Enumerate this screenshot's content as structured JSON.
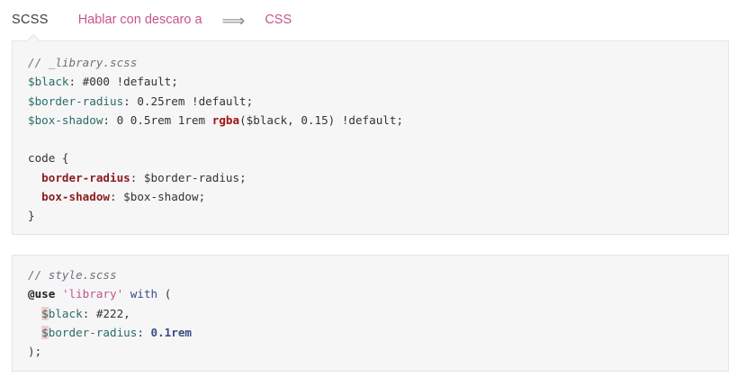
{
  "tabs": {
    "scss": "SCSS",
    "middle": "Hablar con descaro a",
    "arrow": "⟹",
    "css": "CSS"
  },
  "block1": {
    "l1_comment": "// _library.scss",
    "l2_var": "$black",
    "l2_rest": ": #000 ",
    "l2_flag": "!default;",
    "l3_var": "$border-radius",
    "l3_rest": ": 0.25rem ",
    "l3_flag": "!default;",
    "l4_var": "$box-shadow",
    "l4_rest": ": 0 0.5rem 1rem ",
    "l4_fn": "rgba",
    "l4_args": "($black, 0.15) ",
    "l4_flag": "!default;",
    "l6_sel": "code {",
    "l7_prop": "border-radius",
    "l7_rest": ": $border-radius;",
    "l8_prop": "box-shadow",
    "l8_rest": ": $box-shadow;",
    "l9_close": "}"
  },
  "block2": {
    "l1_comment": "// style.scss",
    "l2_at": "@use",
    "l2_str": "'library'",
    "l2_kw": "with",
    "l2_paren": "(",
    "l3_dollar": "$",
    "l3_name": "black",
    "l3_rest": ": #222,",
    "l4_dollar": "$",
    "l4_name": "border-radius",
    "l4_colon": ": ",
    "l4_num": "0.1rem",
    "l5_close": ");"
  }
}
